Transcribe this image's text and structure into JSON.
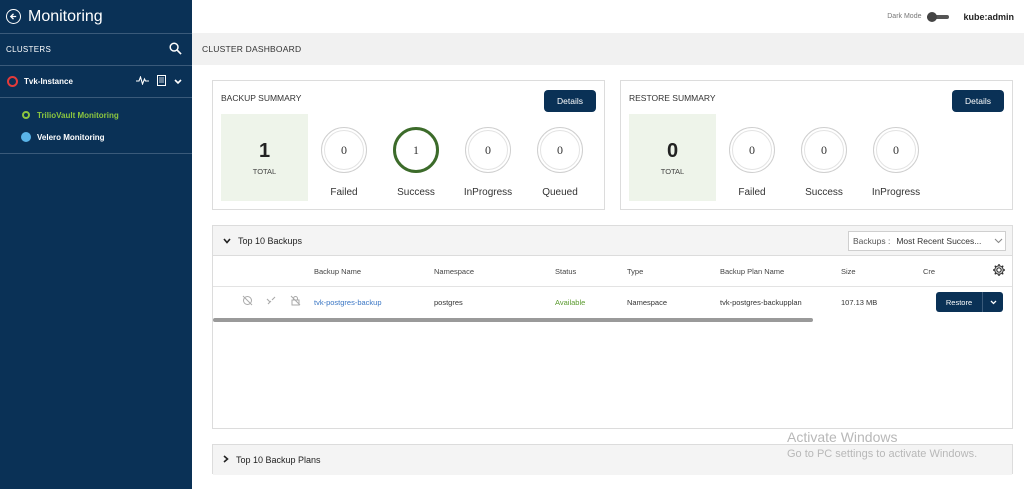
{
  "sidebar": {
    "title": "Monitoring",
    "clusters_label": "CLUSTERS",
    "instance": "Tvk-Instance",
    "items": [
      {
        "label": "TrilioVault Monitoring",
        "active": true
      },
      {
        "label": "Velero Monitoring",
        "active": false
      }
    ]
  },
  "topbar": {
    "dark_mode_label": "Dark Mode",
    "user": "kube:admin"
  },
  "dashboard": {
    "title": "CLUSTER DASHBOARD"
  },
  "backup_summary": {
    "title": "BACKUP SUMMARY",
    "details_label": "Details",
    "total": {
      "value": "1",
      "label": "TOTAL"
    },
    "metrics": [
      {
        "value": "0",
        "label": "Failed"
      },
      {
        "value": "1",
        "label": "Success"
      },
      {
        "value": "0",
        "label": "InProgress"
      },
      {
        "value": "0",
        "label": "Queued"
      }
    ]
  },
  "restore_summary": {
    "title": "RESTORE SUMMARY",
    "details_label": "Details",
    "total": {
      "value": "0",
      "label": "TOTAL"
    },
    "metrics": [
      {
        "value": "0",
        "label": "Failed"
      },
      {
        "value": "0",
        "label": "Success"
      },
      {
        "value": "0",
        "label": "InProgress"
      }
    ]
  },
  "top_backups": {
    "title": "Top 10 Backups",
    "filter_label": "Backups :",
    "filter_value": "Most Recent Succes...",
    "columns": [
      "Backup Name",
      "Namespace",
      "Status",
      "Type",
      "Backup Plan Name",
      "Size",
      "Cre"
    ],
    "rows": [
      {
        "name": "tvk-postgres-backup",
        "namespace": "postgres",
        "status": "Available",
        "type": "Namespace",
        "plan": "tvk-postgres-backupplan",
        "size": "107.13 MB"
      }
    ],
    "restore_label": "Restore"
  },
  "top_plans": {
    "title": "Top 10 Backup Plans"
  },
  "watermark": {
    "line1": "Activate Windows",
    "line2": "Go to PC settings to activate Windows."
  },
  "colors": {
    "sidebar": "#0a3156",
    "accent_green": "#8cc63f",
    "success_ring": "#3c6b2a",
    "link": "#3a76c4"
  }
}
